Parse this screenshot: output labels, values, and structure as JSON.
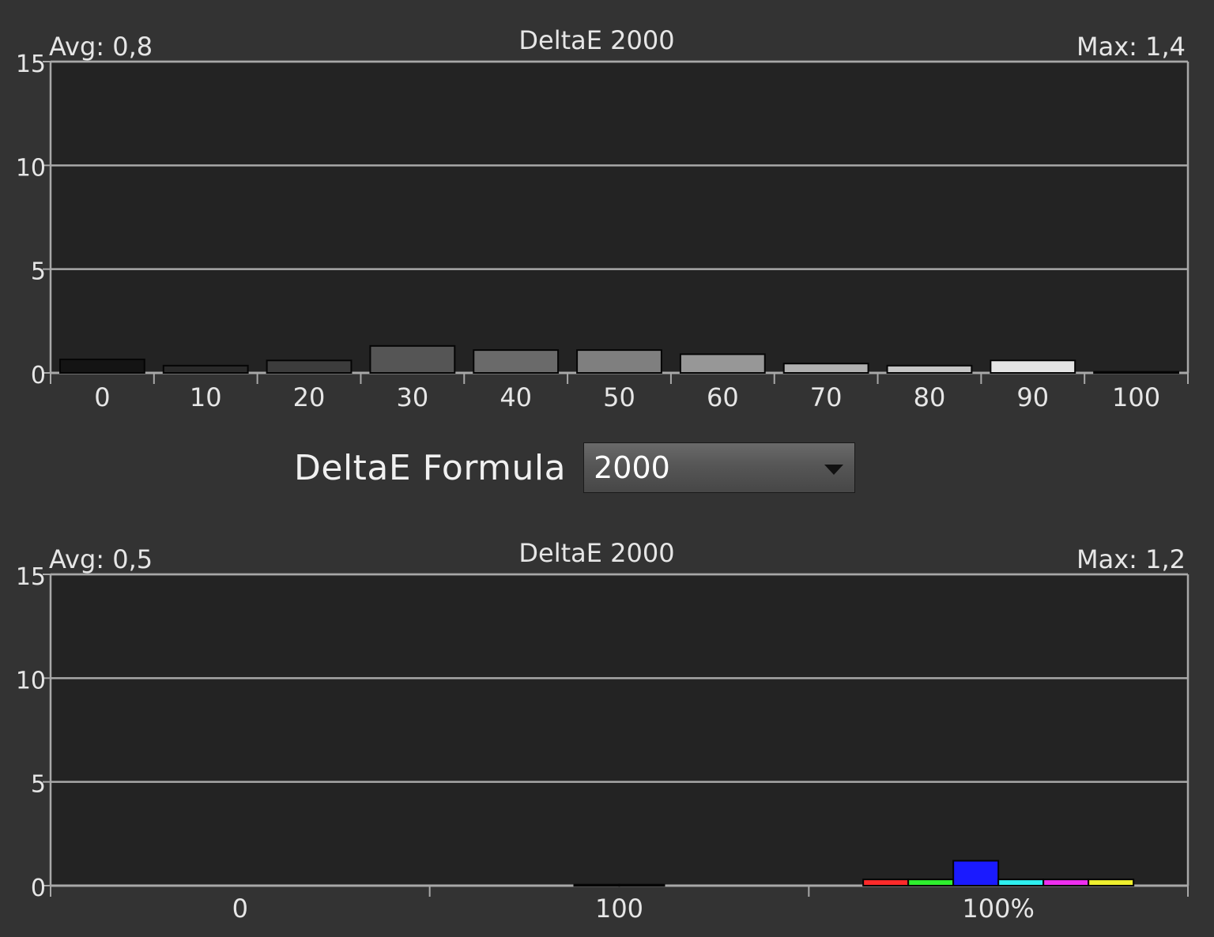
{
  "formula": {
    "label": "DeltaE Formula",
    "selected": "2000"
  },
  "colors": {
    "background": "#333333",
    "plot_background": "#232323",
    "grid": "#a8a8a8",
    "text": "#e6e6e6"
  },
  "chart_data": [
    {
      "type": "bar",
      "title": "DeltaE 2000",
      "avg_label": "Avg: 0,8",
      "max_label": "Max: 1,4",
      "ylim": [
        0,
        15
      ],
      "yticks": [
        0,
        5,
        10,
        15
      ],
      "grid": true,
      "categories": [
        "0",
        "10",
        "20",
        "30",
        "40",
        "50",
        "60",
        "70",
        "80",
        "90",
        "100"
      ],
      "values": [
        0.65,
        0.35,
        0.6,
        1.3,
        1.1,
        1.1,
        0.9,
        0.45,
        0.35,
        0.6,
        0.05
      ],
      "bar_colors": [
        "#141414",
        "#2a2a2a",
        "#3c3c3c",
        "#555555",
        "#6a6a6a",
        "#7f7f7f",
        "#979797",
        "#b0b0b0",
        "#c6c6c6",
        "#e4e4e4",
        "#f6f6f6"
      ]
    },
    {
      "type": "bar",
      "title": "DeltaE 2000",
      "avg_label": "Avg: 0,5",
      "max_label": "Max: 1,2",
      "ylim": [
        0,
        15
      ],
      "yticks": [
        0,
        5,
        10,
        15
      ],
      "grid": true,
      "group_labels": [
        "0",
        "100",
        "100%"
      ],
      "groups": [
        {
          "label": "0",
          "values": []
        },
        {
          "label": "100",
          "values": [
            0.05,
            0.05
          ],
          "colors": [
            "#2e2e2e",
            "#2e2e2e"
          ]
        },
        {
          "label": "100%",
          "values": [
            0.3,
            0.3,
            1.2,
            0.3,
            0.3,
            0.3
          ],
          "colors": [
            "#ff2a2a",
            "#2ef02e",
            "#1a1aff",
            "#2ef0f0",
            "#f02ef0",
            "#f0f02e"
          ]
        }
      ]
    }
  ]
}
